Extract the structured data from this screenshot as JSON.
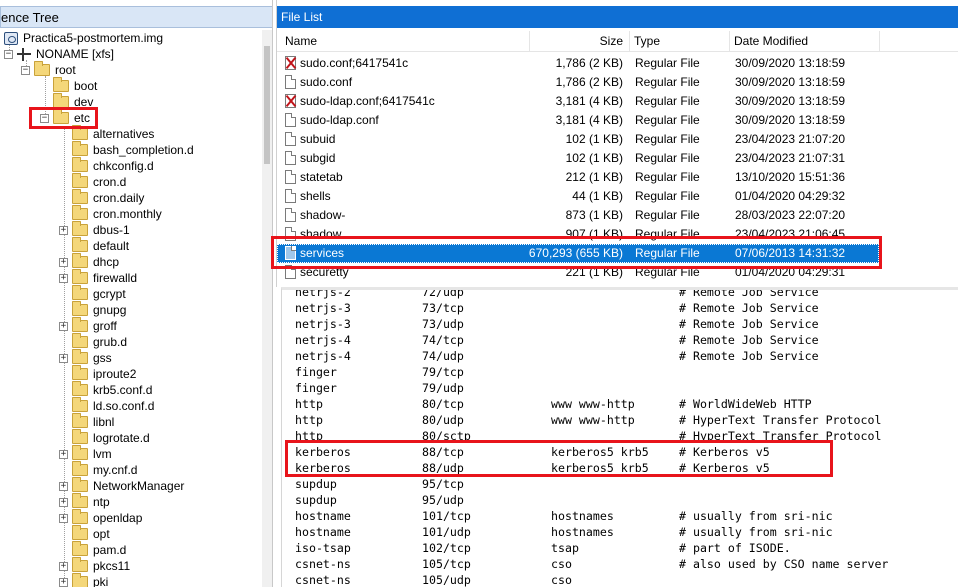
{
  "tree": {
    "header_title": "ence Tree",
    "image_label": "Practica5-postmortem.img",
    "volume_label": "NONAME [xfs]",
    "root_label": "root",
    "top_folders": [
      "boot",
      "dev"
    ],
    "selected_folder": "etc",
    "etc_children": [
      {
        "label": "alternatives",
        "expandable": false
      },
      {
        "label": "bash_completion.d",
        "expandable": false
      },
      {
        "label": "chkconfig.d",
        "expandable": false
      },
      {
        "label": "cron.d",
        "expandable": false
      },
      {
        "label": "cron.daily",
        "expandable": false
      },
      {
        "label": "cron.monthly",
        "expandable": false
      },
      {
        "label": "dbus-1",
        "expandable": true
      },
      {
        "label": "default",
        "expandable": false
      },
      {
        "label": "dhcp",
        "expandable": true
      },
      {
        "label": "firewalld",
        "expandable": true
      },
      {
        "label": "gcrypt",
        "expandable": false
      },
      {
        "label": "gnupg",
        "expandable": false
      },
      {
        "label": "groff",
        "expandable": true
      },
      {
        "label": "grub.d",
        "expandable": false
      },
      {
        "label": "gss",
        "expandable": true
      },
      {
        "label": "iproute2",
        "expandable": false
      },
      {
        "label": "krb5.conf.d",
        "expandable": false
      },
      {
        "label": "ld.so.conf.d",
        "expandable": false
      },
      {
        "label": "libnl",
        "expandable": false
      },
      {
        "label": "logrotate.d",
        "expandable": false
      },
      {
        "label": "lvm",
        "expandable": true
      },
      {
        "label": "my.cnf.d",
        "expandable": false
      },
      {
        "label": "NetworkManager",
        "expandable": true
      },
      {
        "label": "ntp",
        "expandable": true
      },
      {
        "label": "openldap",
        "expandable": true
      },
      {
        "label": "opt",
        "expandable": false
      },
      {
        "label": "pam.d",
        "expandable": false
      },
      {
        "label": "pkcs11",
        "expandable": true
      },
      {
        "label": "pki",
        "expandable": true
      }
    ]
  },
  "file_list": {
    "title": "File List",
    "columns": {
      "name": "Name",
      "size": "Size",
      "type": "Type",
      "date": "Date Modified"
    },
    "rows": [
      {
        "name": "sudo.conf;6417541c",
        "size": "1,786 (2 KB)",
        "type": "Regular File",
        "date": "30/09/2020 13:18:59",
        "deleted": true,
        "selected": false
      },
      {
        "name": "sudo.conf",
        "size": "1,786 (2 KB)",
        "type": "Regular File",
        "date": "30/09/2020 13:18:59",
        "deleted": false,
        "selected": false
      },
      {
        "name": "sudo-ldap.conf;6417541c",
        "size": "3,181 (4 KB)",
        "type": "Regular File",
        "date": "30/09/2020 13:18:59",
        "deleted": true,
        "selected": false
      },
      {
        "name": "sudo-ldap.conf",
        "size": "3,181 (4 KB)",
        "type": "Regular File",
        "date": "30/09/2020 13:18:59",
        "deleted": false,
        "selected": false
      },
      {
        "name": "subuid",
        "size": "102 (1 KB)",
        "type": "Regular File",
        "date": "23/04/2023 21:07:20",
        "deleted": false,
        "selected": false
      },
      {
        "name": "subgid",
        "size": "102 (1 KB)",
        "type": "Regular File",
        "date": "23/04/2023 21:07:31",
        "deleted": false,
        "selected": false
      },
      {
        "name": "statetab",
        "size": "212 (1 KB)",
        "type": "Regular File",
        "date": "13/10/2020 15:51:36",
        "deleted": false,
        "selected": false
      },
      {
        "name": "shells",
        "size": "44 (1 KB)",
        "type": "Regular File",
        "date": "01/04/2020 04:29:32",
        "deleted": false,
        "selected": false
      },
      {
        "name": "shadow-",
        "size": "873 (1 KB)",
        "type": "Regular File",
        "date": "28/03/2023 22:07:20",
        "deleted": false,
        "selected": false
      },
      {
        "name": "shadow",
        "size": "907 (1 KB)",
        "type": "Regular File",
        "date": "23/04/2023 21:06:45",
        "deleted": false,
        "selected": false
      },
      {
        "name": "services",
        "size": "670,293 (655 KB)",
        "type": "Regular File",
        "date": "07/06/2013 14:31:32",
        "deleted": false,
        "selected": true
      },
      {
        "name": "securetty",
        "size": "221 (1 KB)",
        "type": "Regular File",
        "date": "01/04/2020 04:29:31",
        "deleted": false,
        "selected": false
      }
    ]
  },
  "content": {
    "lines": [
      {
        "svc": "netrjs-2",
        "port": "72/udp",
        "alias": "",
        "comment": "# Remote Job Service"
      },
      {
        "svc": "netrjs-3",
        "port": "73/tcp",
        "alias": "",
        "comment": "# Remote Job Service"
      },
      {
        "svc": "netrjs-3",
        "port": "73/udp",
        "alias": "",
        "comment": "# Remote Job Service"
      },
      {
        "svc": "netrjs-4",
        "port": "74/tcp",
        "alias": "",
        "comment": "# Remote Job Service"
      },
      {
        "svc": "netrjs-4",
        "port": "74/udp",
        "alias": "",
        "comment": "# Remote Job Service"
      },
      {
        "svc": "finger",
        "port": "79/tcp",
        "alias": "",
        "comment": ""
      },
      {
        "svc": "finger",
        "port": "79/udp",
        "alias": "",
        "comment": ""
      },
      {
        "svc": "http",
        "port": "80/tcp",
        "alias": "www www-http",
        "comment": "# WorldWideWeb HTTP"
      },
      {
        "svc": "http",
        "port": "80/udp",
        "alias": "www www-http",
        "comment": "# HyperText Transfer Protocol"
      },
      {
        "svc": "http",
        "port": "80/sctp",
        "alias": "",
        "comment": "# HyperText Transfer Protocol"
      },
      {
        "svc": "kerberos",
        "port": "88/tcp",
        "alias": "kerberos5 krb5",
        "comment": "# Kerberos v5"
      },
      {
        "svc": "kerberos",
        "port": "88/udp",
        "alias": "kerberos5 krb5",
        "comment": "# Kerberos v5"
      },
      {
        "svc": "supdup",
        "port": "95/tcp",
        "alias": "",
        "comment": ""
      },
      {
        "svc": "supdup",
        "port": "95/udp",
        "alias": "",
        "comment": ""
      },
      {
        "svc": "hostname",
        "port": "101/tcp",
        "alias": "hostnames",
        "comment": "# usually from sri-nic"
      },
      {
        "svc": "hostname",
        "port": "101/udp",
        "alias": "hostnames",
        "comment": "# usually from sri-nic"
      },
      {
        "svc": "iso-tsap",
        "port": "102/tcp",
        "alias": "tsap",
        "comment": "# part of ISODE."
      },
      {
        "svc": "csnet-ns",
        "port": "105/tcp",
        "alias": "cso",
        "comment": "# also used by CSO name server"
      },
      {
        "svc": "csnet-ns",
        "port": "105/udp",
        "alias": "cso",
        "comment": ""
      }
    ]
  }
}
